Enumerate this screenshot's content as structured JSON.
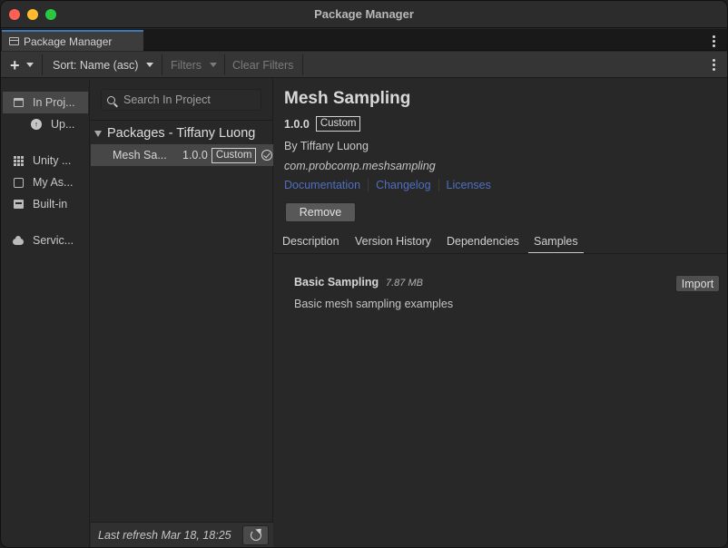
{
  "window": {
    "title": "Package Manager"
  },
  "tab": {
    "label": "Package Manager"
  },
  "toolbar": {
    "add_label": "+",
    "sort_label": "Sort: Name (asc)",
    "filters_label": "Filters",
    "clear_filters_label": "Clear Filters"
  },
  "sidebar": {
    "items": [
      {
        "label": "In Proj...",
        "icon": "window-icon",
        "active": true
      },
      {
        "label": "Up...",
        "icon": "update-icon"
      },
      {
        "label": "Unity ...",
        "icon": "grid-icon"
      },
      {
        "label": "My As...",
        "icon": "package-box-icon"
      },
      {
        "label": "Built-in",
        "icon": "builtin-icon"
      },
      {
        "label": "Servic...",
        "icon": "cloud-icon"
      }
    ]
  },
  "list": {
    "search_placeholder": "Search In Project",
    "group_title": "Packages - Tiffany Luong",
    "packages": [
      {
        "name": "Mesh Sa...",
        "version": "1.0.0",
        "badge": "Custom"
      }
    ],
    "footer": "Last refresh Mar 18, 18:25"
  },
  "details": {
    "title": "Mesh Sampling",
    "version": "1.0.0",
    "badge": "Custom",
    "author": "By Tiffany Luong",
    "package_id": "com.probcomp.meshsampling",
    "links": {
      "documentation": "Documentation",
      "changelog": "Changelog",
      "licenses": "Licenses"
    },
    "remove_label": "Remove",
    "tabs": {
      "description": "Description",
      "version_history": "Version History",
      "dependencies": "Dependencies",
      "samples": "Samples"
    },
    "active_tab": "Samples",
    "sample": {
      "title": "Basic Sampling",
      "size": "7.87 MB",
      "description": "Basic mesh sampling examples",
      "import_label": "Import"
    }
  },
  "colors": {
    "accent_tab": "#3a79bb",
    "link": "#4f6fbf",
    "close": "#fe5f57",
    "minimize": "#febc2e",
    "maximize": "#28c840"
  }
}
